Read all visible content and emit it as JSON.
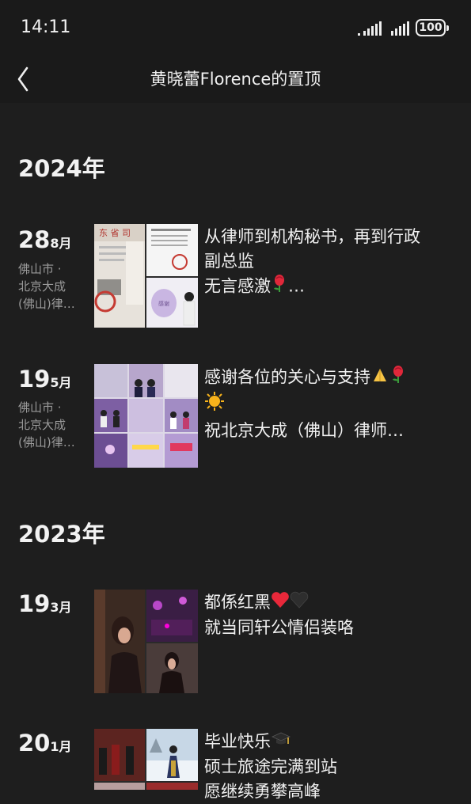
{
  "status_bar": {
    "time": "14:11",
    "battery": "100"
  },
  "nav": {
    "title": "黄晓蕾Florence的置顶"
  },
  "sections": [
    {
      "year": "2024年"
    },
    {
      "year": "2023年"
    }
  ],
  "posts": [
    {
      "day": "28",
      "month": "8月",
      "location_lines": [
        "佛山市 ·",
        "北京大成",
        "(佛山)律…"
      ],
      "caption_lines": [
        "从律师到机构秘书，再到行政",
        "副总监",
        "无言感激"
      ],
      "caption_suffix": "…",
      "emoji": [
        "rose-emoji"
      ]
    },
    {
      "day": "19",
      "month": "5月",
      "location_lines": [
        "佛山市 ·",
        "北京大成",
        "(佛山)律…"
      ],
      "caption_lines": [
        "感谢各位的关心与支持",
        "",
        "祝北京大成（佛山）律师…"
      ],
      "emoji": [
        "praying-hands-emoji",
        "rose-emoji",
        "sun-emoji"
      ]
    },
    {
      "day": "19",
      "month": "3月",
      "location_lines": [],
      "caption_lines": [
        "都係红黑",
        "就当同轩公情侣装咯"
      ],
      "emoji": [
        "red-heart-emoji",
        "black-heart-emoji"
      ]
    },
    {
      "day": "20",
      "month": "1月",
      "location_lines": [],
      "caption_lines": [
        "毕业快乐",
        "硕士旅途完满到站",
        "愿继续勇攀高峰"
      ],
      "emoji": [
        "graduation-cap-emoji"
      ]
    }
  ]
}
